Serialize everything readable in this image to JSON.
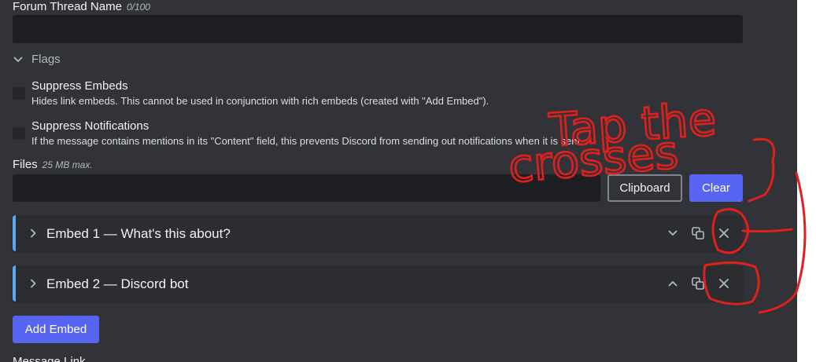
{
  "form": {
    "thread_name": {
      "label": "Forum Thread Name",
      "counter": "0/100",
      "value": ""
    },
    "flags": {
      "header": "Flags",
      "items": [
        {
          "title": "Suppress Embeds",
          "description": "Hides link embeds. This cannot be used in conjunction with rich embeds (created with \"Add Embed\").",
          "checked": false
        },
        {
          "title": "Suppress Notifications",
          "description": "If the message contains mentions in its \"Content\" field, this prevents Discord from sending out notifications when it is sent.",
          "checked": false
        }
      ]
    },
    "files": {
      "label": "Files",
      "hint": "25 MB max.",
      "clipboard_label": "Clipboard",
      "clear_label": "Clear"
    },
    "embeds": [
      {
        "title": "Embed 1 — What's this about?",
        "collapse_icon": "chevron-down-icon"
      },
      {
        "title": "Embed 2 — Discord bot",
        "collapse_icon": "chevron-up-icon"
      }
    ],
    "add_embed_label": "Add Embed",
    "message_link_label": "Message Link"
  },
  "annotation": {
    "text": "Tap the crosses",
    "color": "#e0201c"
  },
  "colors": {
    "panel_bg": "#313338",
    "input_bg": "#1e1f22",
    "embed_bg": "#2b2d31",
    "embed_accent": "#5ba7f4",
    "primary": "#5865f2"
  }
}
